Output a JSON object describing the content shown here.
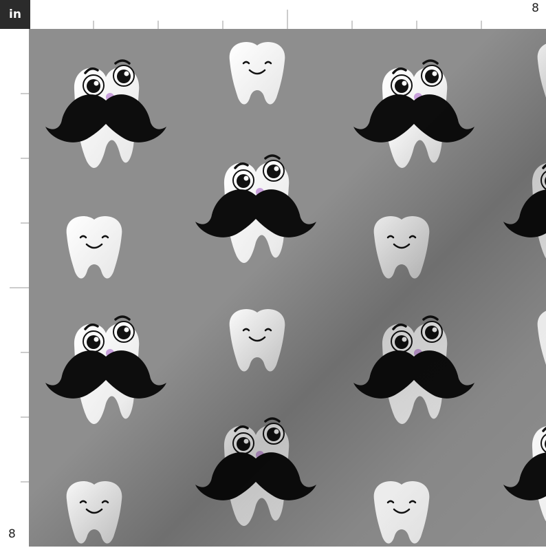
{
  "ruler": {
    "unit_label": "in",
    "top_end_label": "8",
    "left_end_label": "8"
  },
  "fabric": {
    "background_color": "#8e8e8e",
    "tooth_color": "#ffffff",
    "mustache_color": "#0d0d0d",
    "nose_color": "#c9a0dc",
    "pattern_motifs": [
      "mustache-tooth-icon",
      "smiling-tooth-icon"
    ]
  }
}
